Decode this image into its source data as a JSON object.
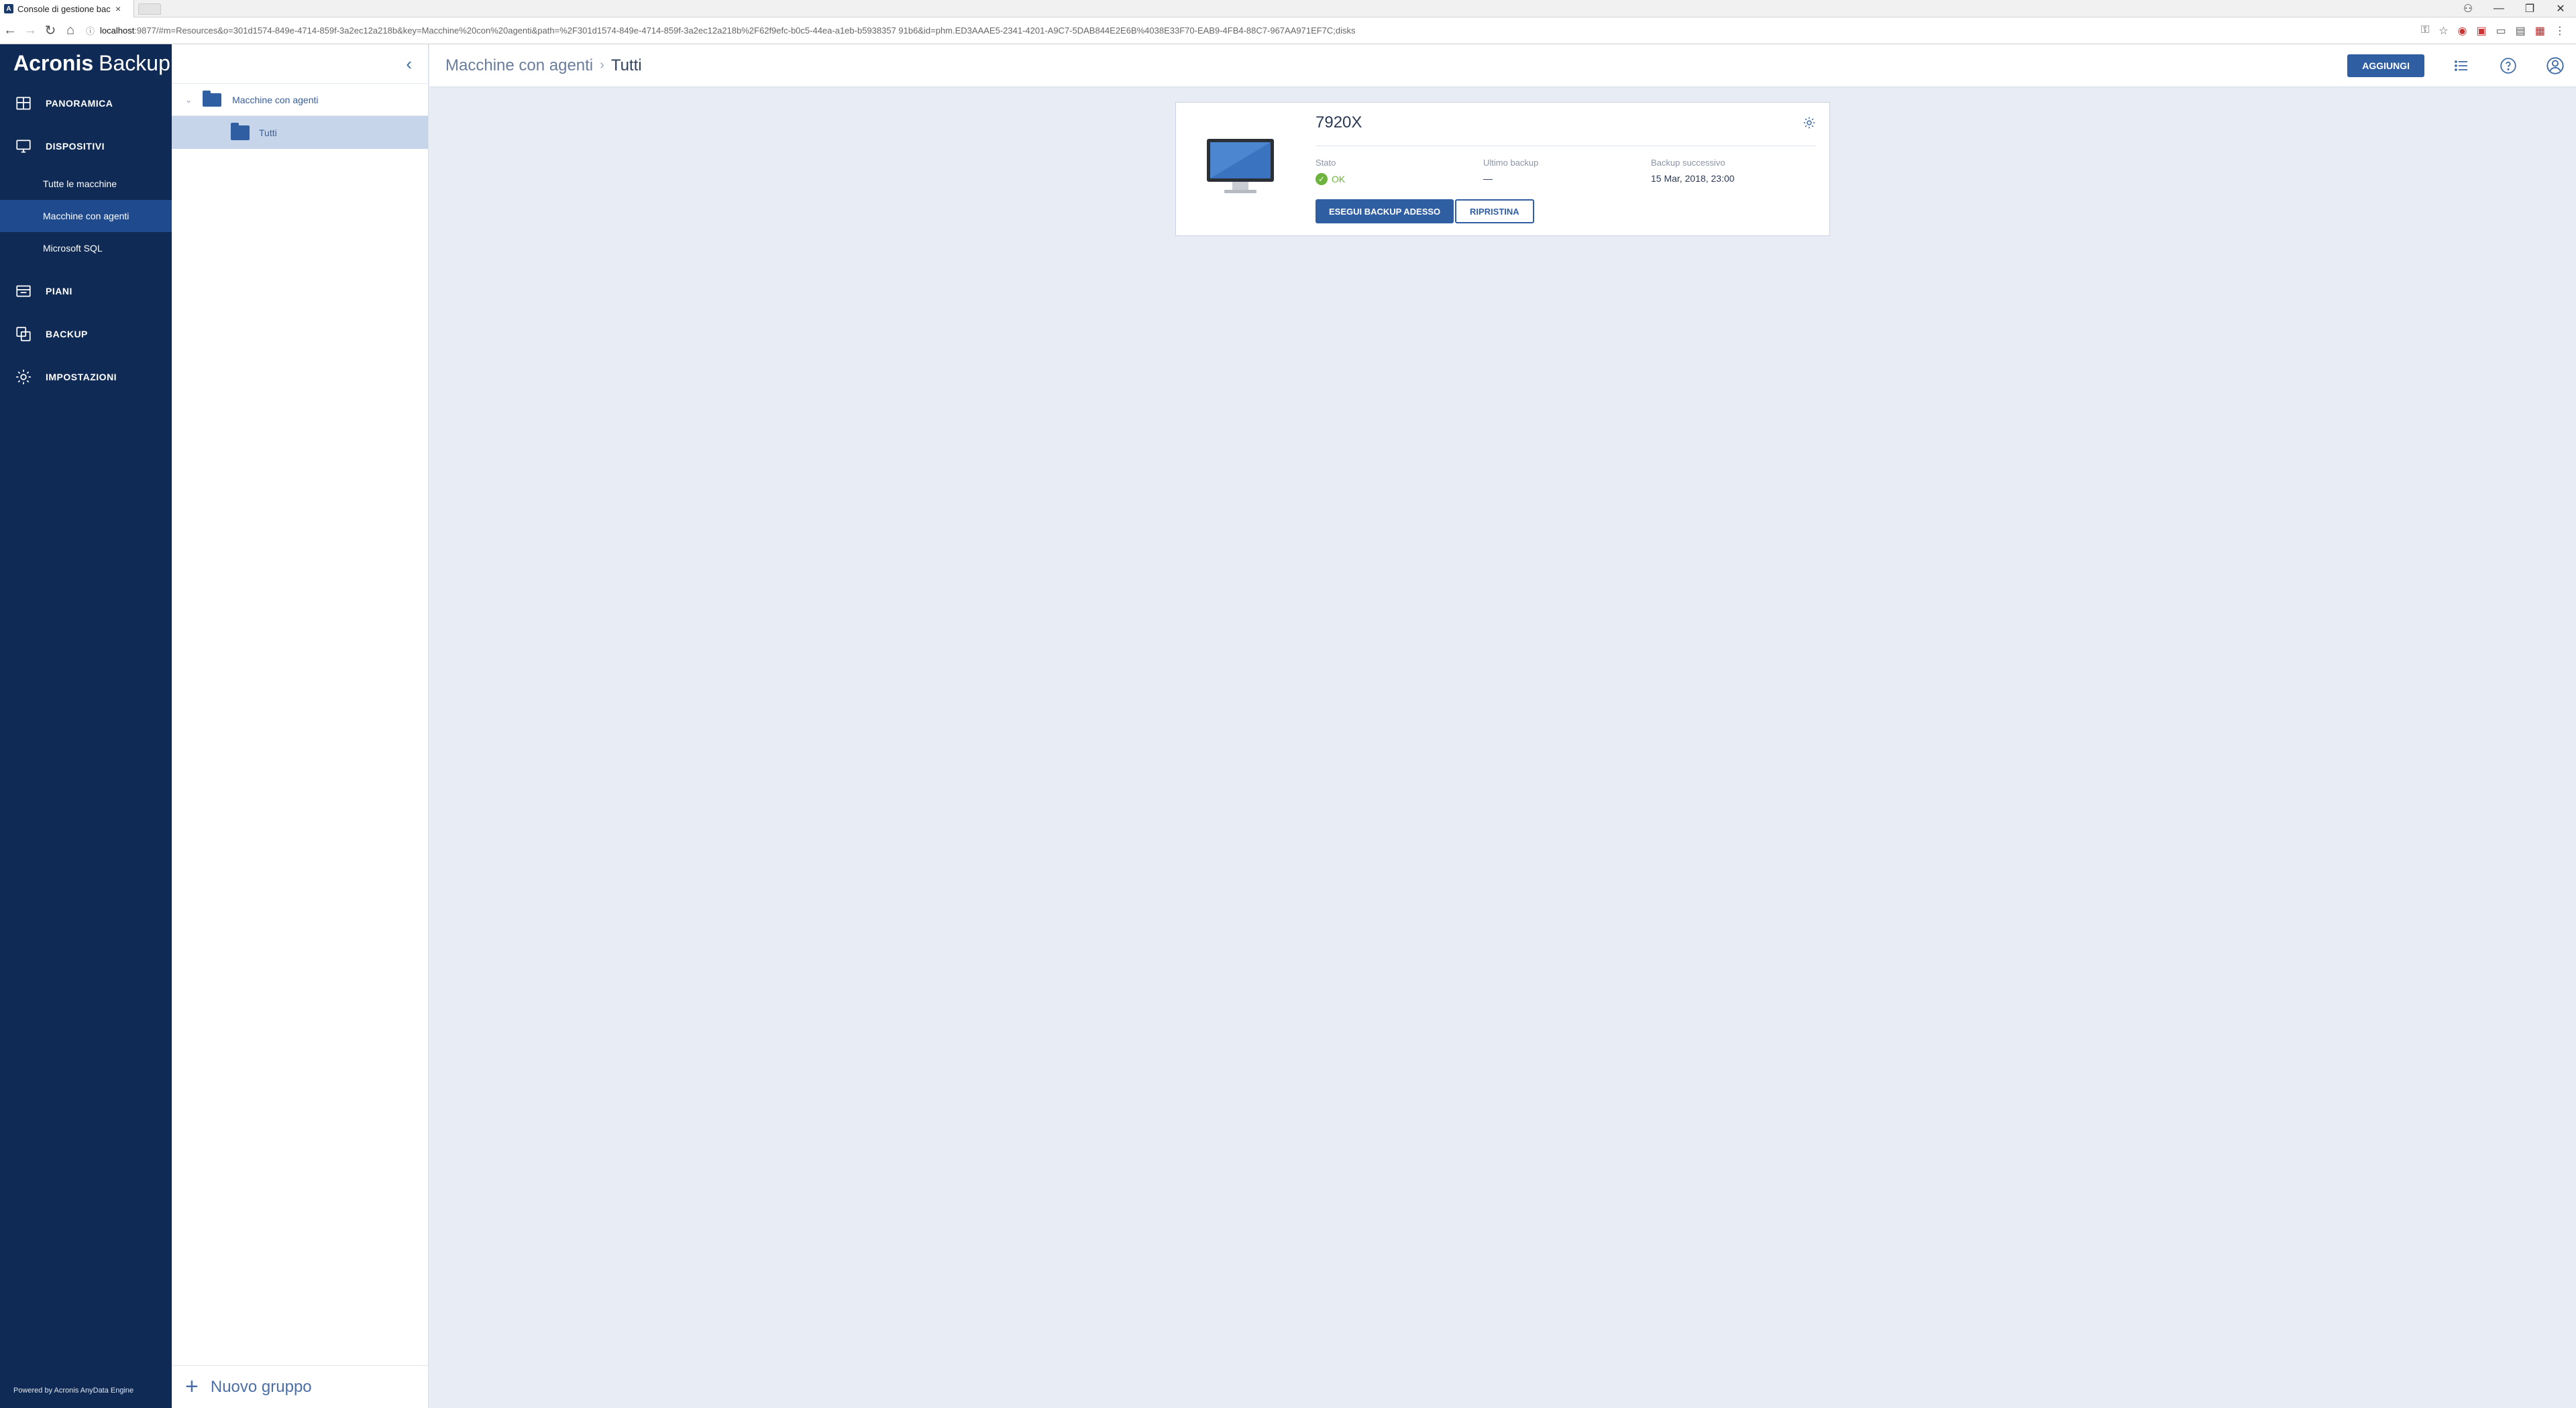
{
  "browser": {
    "tab_title": "Console di gestione bac",
    "tab_favicon": "A",
    "url_host": "localhost",
    "url_rest": ":9877/#m=Resources&o=301d1574-849e-4714-859f-3a2ec12a218b&key=Macchine%20con%20agenti&path=%2F301d1574-849e-4714-859f-3a2ec12a218b%2F62f9efc-b0c5-44ea-a1eb-b5938357 91b6&id=phm.ED3AAAE5-2341-4201-A9C7-5DAB844E2E6B%4038E33F70-EAB9-4FB4-88C7-967AA971EF7C;disks"
  },
  "app": {
    "logo_bold": "Acronis",
    "logo_light": "Backup",
    "powered_by": "Powered by Acronis AnyData Engine"
  },
  "sidebar": {
    "items": [
      {
        "label": "PANORAMICA",
        "icon": "dashboard-icon"
      },
      {
        "label": "DISPOSITIVI",
        "icon": "devices-icon"
      },
      {
        "label": "PIANI",
        "icon": "plans-icon"
      },
      {
        "label": "BACKUP",
        "icon": "backup-icon"
      },
      {
        "label": "IMPOSTAZIONI",
        "icon": "gear-icon"
      }
    ],
    "sub_items": [
      {
        "label": "Tutte le macchine"
      },
      {
        "label": "Macchine con agenti"
      },
      {
        "label": "Microsoft SQL"
      }
    ]
  },
  "tree": {
    "root_label": "Macchine con agenti",
    "child_label": "Tutti",
    "new_group_label": "Nuovo gruppo"
  },
  "main": {
    "breadcrumb": [
      "Macchine con agenti",
      "Tutti"
    ],
    "add_button": "AGGIUNGI"
  },
  "machine": {
    "name": "7920X",
    "status_label": "Stato",
    "status_value": "OK",
    "last_backup_label": "Ultimo backup",
    "last_backup_value": "—",
    "next_backup_label": "Backup successivo",
    "next_backup_value": "15 Mar, 2018, 23:00",
    "backup_now_button": "ESEGUI BACKUP ADESSO",
    "restore_button": "RIPRISTINA"
  },
  "colors": {
    "sidebar_bg": "#0f2a55",
    "accent": "#2f5ea2",
    "ok": "#6cb33e"
  }
}
